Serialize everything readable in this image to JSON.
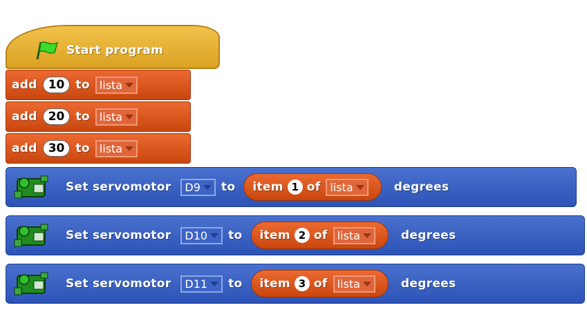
{
  "hat": {
    "label": "Start program",
    "icon": "green-flag-icon"
  },
  "add_blocks": [
    {
      "prefix": "add",
      "value": "10",
      "mid": "to",
      "list": "lista"
    },
    {
      "prefix": "add",
      "value": "20",
      "mid": "to",
      "list": "lista"
    },
    {
      "prefix": "add",
      "value": "30",
      "mid": "to",
      "list": "lista"
    }
  ],
  "servo_blocks": [
    {
      "label": "Set servomotor",
      "port": "D9",
      "to": "to",
      "item": "item",
      "index": "1",
      "of": "of",
      "list": "lista",
      "suffix": "degrees"
    },
    {
      "label": "Set servomotor",
      "port": "D10",
      "to": "to",
      "item": "item",
      "index": "2",
      "of": "of",
      "list": "lista",
      "suffix": "degrees"
    },
    {
      "label": "Set servomotor",
      "port": "D11",
      "to": "to",
      "item": "item",
      "index": "3",
      "of": "of",
      "list": "lista",
      "suffix": "degrees"
    }
  ],
  "colors": {
    "hat": "#e3ab2c",
    "list_block": "#dc5a1f",
    "motion_block": "#3b62c4"
  }
}
